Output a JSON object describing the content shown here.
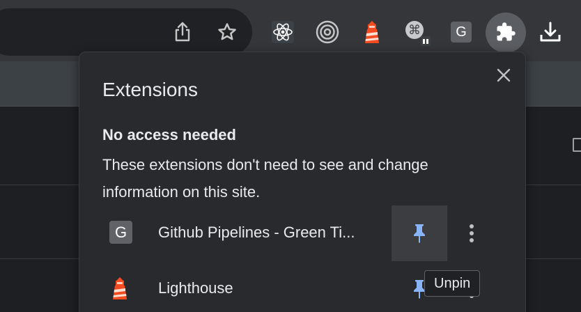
{
  "toolbar": {
    "icons": [
      "share-icon",
      "bookmark-star-icon",
      "react-devtools-icon",
      "target-extension-icon",
      "lighthouse-icon",
      "command-key-extension-icon",
      "github-pipelines-g-icon",
      "extensions-puzzle-icon",
      "download-icon"
    ],
    "g_letter": "G"
  },
  "popup": {
    "title": "Extensions",
    "close_icon": "close-icon",
    "section": {
      "heading": "No access needed",
      "description": "These extensions don't need to see and change information on this site."
    },
    "extensions": [
      {
        "name": "Github Pipelines - Green Ti...",
        "icon": "github-pipelines-g-icon",
        "icon_letter": "G",
        "pinned": true
      },
      {
        "name": "Lighthouse",
        "icon": "lighthouse-icon",
        "pinned": true
      }
    ]
  },
  "tooltip": {
    "text": "Unpin"
  },
  "colors": {
    "pin_blue": "#8ab4f8",
    "lighthouse_red": "#f44b21",
    "popup_bg": "#292a2d",
    "text": "#e8eaed"
  }
}
